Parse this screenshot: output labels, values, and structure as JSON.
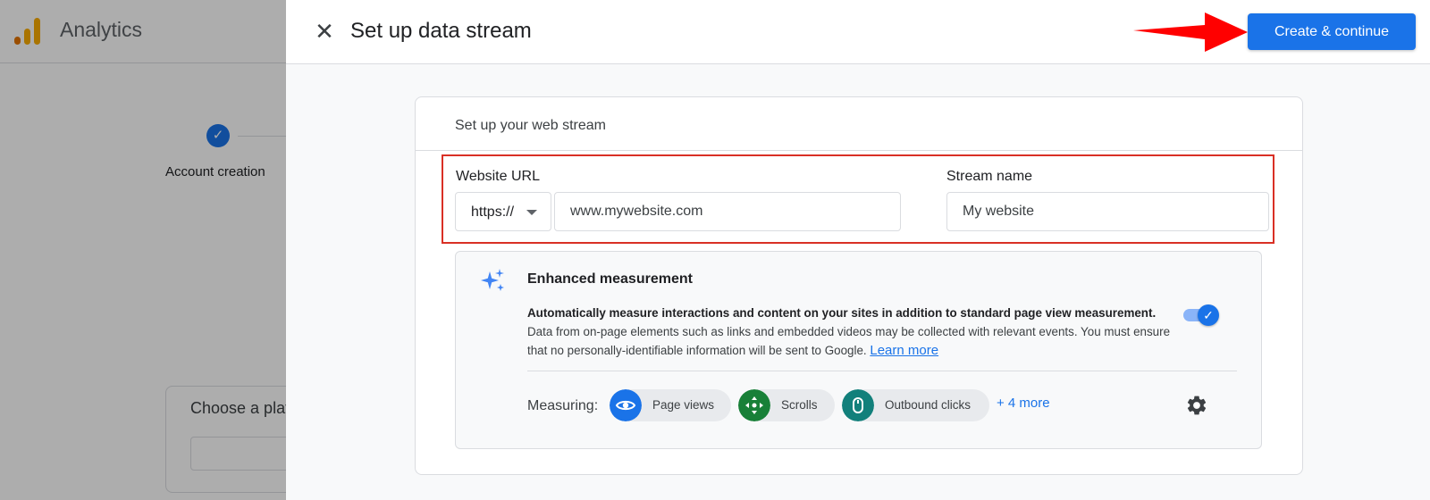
{
  "background": {
    "app_title": "Analytics",
    "step_check": "✓",
    "step_label": "Account creation",
    "card_title": "Choose a platform"
  },
  "panel": {
    "close_glyph": "✕",
    "title": "Set up data stream",
    "create_button": "Create & continue"
  },
  "stream": {
    "section_title": "Set up your web stream",
    "url_label": "Website URL",
    "protocol": "https://",
    "url_value": "www.mywebsite.com",
    "name_label": "Stream name",
    "name_value": "My website"
  },
  "enhanced": {
    "title": "Enhanced measurement",
    "desc_bold": "Automatically measure interactions and content on your sites in addition to standard page view measurement.",
    "desc_rest": "Data from on-page elements such as links and embedded videos may be collected with relevant events. You must ensure that no personally-identifiable information will be sent to Google.",
    "learn_more": "Learn more",
    "toggle_on": true,
    "toggle_check": "✓",
    "measuring_label": "Measuring:",
    "chips": [
      {
        "label": "Page views",
        "icon": "eye-icon",
        "color": "#1a73e8"
      },
      {
        "label": "Scrolls",
        "icon": "scroll-move-icon",
        "color": "#188038"
      },
      {
        "label": "Outbound clicks",
        "icon": "mouse-icon",
        "color": "#12807b"
      }
    ],
    "more": "+ 4 more"
  },
  "colors": {
    "primary": "#1a73e8",
    "highlight": "#d93025",
    "arrow": "#ff0000"
  }
}
